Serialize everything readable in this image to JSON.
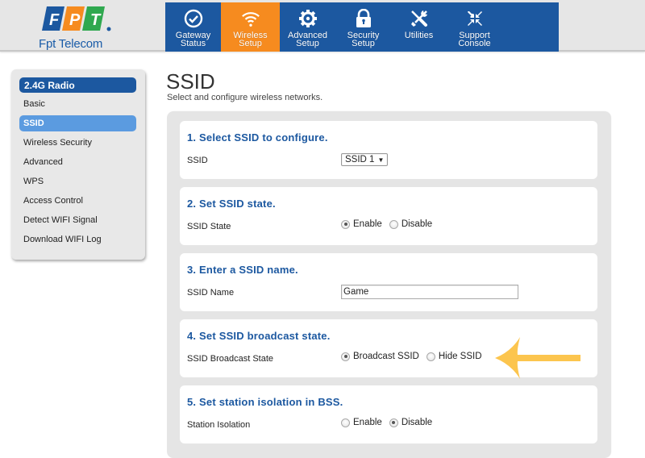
{
  "brand": {
    "logo_letters": [
      "F",
      "P",
      "T"
    ],
    "logo_colors": [
      "#1c58a0",
      "#f68b1f",
      "#2fa84f"
    ],
    "name": "Fpt Telecom"
  },
  "nav": {
    "items": [
      {
        "label": "Gateway\nStatus",
        "icon": "check-circle-icon",
        "active": false
      },
      {
        "label": "Wireless\nSetup",
        "icon": "wifi-icon",
        "active": true
      },
      {
        "label": "Advanced\nSetup",
        "icon": "gear-icon",
        "active": false
      },
      {
        "label": "Security\nSetup",
        "icon": "lock-icon",
        "active": false
      },
      {
        "label": "Utilities",
        "icon": "tools-icon",
        "active": false
      },
      {
        "label": "Support\nConsole",
        "icon": "collapse-arrows-icon",
        "active": false
      }
    ]
  },
  "sidebar": {
    "heading": "2.4G Radio",
    "items": [
      {
        "label": "Basic",
        "active": false
      },
      {
        "label": "SSID",
        "active": true
      },
      {
        "label": "Wireless Security",
        "active": false
      },
      {
        "label": "Advanced",
        "active": false
      },
      {
        "label": "WPS",
        "active": false
      },
      {
        "label": "Access Control",
        "active": false
      },
      {
        "label": "Detect WIFI Signal",
        "active": false
      },
      {
        "label": "Download WIFI Log",
        "active": false
      }
    ]
  },
  "page": {
    "title": "SSID",
    "subtitle": "Select and configure wireless networks."
  },
  "sections": {
    "select_ssid": {
      "title": "1. Select SSID to configure.",
      "label": "SSID",
      "selected": "SSID 1"
    },
    "ssid_state": {
      "title": "2. Set SSID state.",
      "label": "SSID State",
      "options": [
        "Enable",
        "Disable"
      ],
      "selected": "Enable"
    },
    "ssid_name": {
      "title": "3. Enter a SSID name.",
      "label": "SSID Name",
      "value": "Game"
    },
    "broadcast": {
      "title": "4. Set SSID broadcast state.",
      "label": "SSID Broadcast State",
      "options": [
        "Broadcast SSID",
        "Hide SSID"
      ],
      "selected": "Broadcast SSID"
    },
    "isolation": {
      "title": "5. Set station isolation in BSS.",
      "label": "Station Isolation",
      "options": [
        "Enable",
        "Disable"
      ],
      "selected": "Disable"
    }
  },
  "annotation": {
    "arrow_color": "#fcc54e",
    "points_to": "Hide SSID"
  }
}
